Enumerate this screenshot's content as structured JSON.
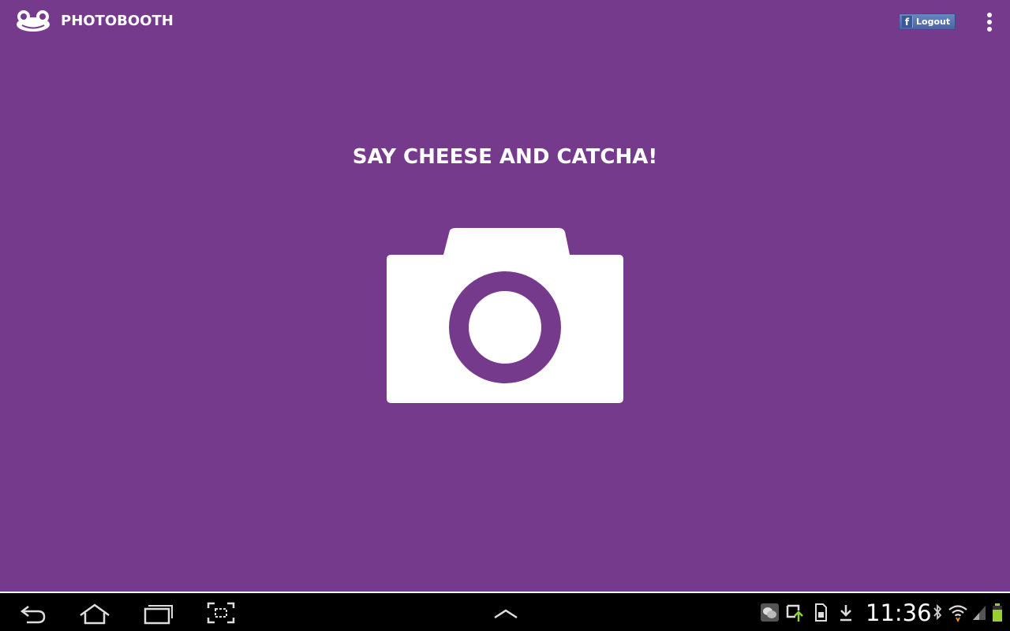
{
  "app": {
    "title": "PHOTOBOOTH",
    "logo_icon": "frog-logo-icon",
    "background_color": "#763a8c"
  },
  "action_bar": {
    "logout_label": "Logout",
    "logout_icon": "facebook-icon",
    "overflow_icon": "more-vertical-icon"
  },
  "main": {
    "headline": "SAY CHEESE AND CATCHA!",
    "camera_icon": "camera-icon"
  },
  "system_nav": {
    "back_icon": "back-icon",
    "home_icon": "home-icon",
    "recents_icon": "recent-apps-icon",
    "screenshot_icon": "screenshot-icon",
    "up_icon": "chevron-up-icon"
  },
  "status_bar": {
    "time": "11:36",
    "icons": [
      "chat-notification-icon",
      "sync-icon",
      "sd-card-icon",
      "download-icon",
      "bluetooth-icon",
      "wifi-icon",
      "signal-icon",
      "battery-icon"
    ],
    "battery_color": "#9acd32"
  }
}
